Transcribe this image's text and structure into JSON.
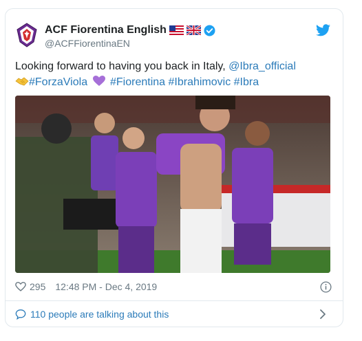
{
  "tweet": {
    "display_name": "ACF Fiorentina English",
    "handle": "@ACFFiorentinaEN",
    "text_intro": "Looking forward to having you back in Italy,",
    "mention": "@Ibra_official",
    "hashtag_forzaviola": "#ForzaViola",
    "hashtags_rest": "#Fiorentina #Ibrahimovic #Ibra",
    "likes": "295",
    "timestamp": "12:48 PM - Dec 4, 2019",
    "footer_text": "110 people are talking about this"
  },
  "icons": {
    "avatar": "fiorentina-crest-icon",
    "flag_us": "us-flag-icon",
    "flag_uk": "uk-flag-icon",
    "verified": "verified-badge-icon",
    "bird": "twitter-bird-icon",
    "clap": "handshake-emoji-icon",
    "heart_emoji": "purple-heart-emoji-icon",
    "like": "heart-outline-icon",
    "info": "info-icon",
    "reply": "speech-bubble-icon",
    "chevron": "chevron-right-icon"
  },
  "colors": {
    "link": "#2b7bb9",
    "muted": "#697882",
    "twitter_blue": "#1da1f2",
    "viola": "#7b3fb8"
  }
}
